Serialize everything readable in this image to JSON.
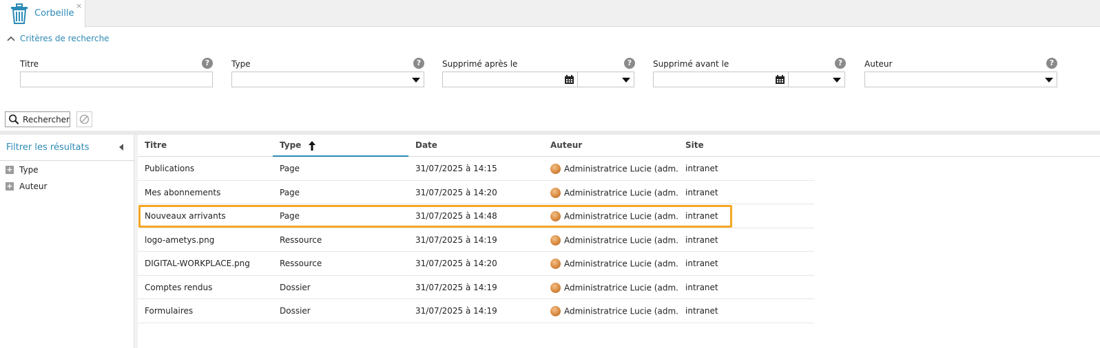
{
  "tab": {
    "label": "Corbeille",
    "close": "×",
    "icon": "trash-icon"
  },
  "criteria": {
    "toggle_label": "Critères de recherche"
  },
  "fields": {
    "titre": {
      "label": "Titre",
      "value": "",
      "help": "?"
    },
    "type": {
      "label": "Type",
      "value": "",
      "help": "?"
    },
    "after": {
      "label": "Supprimé après le",
      "value": "",
      "help": "?"
    },
    "before": {
      "label": "Supprimé avant le",
      "value": "",
      "help": "?"
    },
    "auteur": {
      "label": "Auteur",
      "value": "",
      "help": "?"
    }
  },
  "buttons": {
    "search": "Rechercher"
  },
  "filter": {
    "title": "Filtrer les résultats",
    "items": [
      {
        "label": "Type"
      },
      {
        "label": "Auteur"
      }
    ]
  },
  "grid": {
    "columns": [
      "Titre",
      "Type",
      "Date",
      "Auteur",
      "Site"
    ],
    "sorted_column": "Type",
    "rows": [
      {
        "titre": "Publications",
        "type": "Page",
        "date": "31/07/2025 à 14:15",
        "auteur": "Administratrice Lucie (adm...",
        "site": "intranet"
      },
      {
        "titre": "Mes abonnements",
        "type": "Page",
        "date": "31/07/2025 à 14:20",
        "auteur": "Administratrice Lucie (adm...",
        "site": "intranet"
      },
      {
        "titre": "Nouveaux arrivants",
        "type": "Page",
        "date": "31/07/2025 à 14:48",
        "auteur": "Administratrice Lucie (adm...",
        "site": "intranet"
      },
      {
        "titre": "logo-ametys.png",
        "type": "Ressource",
        "date": "31/07/2025 à 14:19",
        "auteur": "Administratrice Lucie (adm...",
        "site": "intranet"
      },
      {
        "titre": "DIGITAL-WORKPLACE.png",
        "type": "Ressource",
        "date": "31/07/2025 à 14:20",
        "auteur": "Administratrice Lucie (adm...",
        "site": "intranet"
      },
      {
        "titre": "Comptes rendus",
        "type": "Dossier",
        "date": "31/07/2025 à 14:19",
        "auteur": "Administratrice Lucie (adm...",
        "site": "intranet"
      },
      {
        "titre": "Formulaires",
        "type": "Dossier",
        "date": "31/07/2025 à 14:19",
        "auteur": "Administratrice Lucie (adm...",
        "site": "intranet"
      }
    ],
    "highlighted_row": 2
  },
  "colors": {
    "accent": "#2b8ab6",
    "highlight": "#f5a623"
  }
}
